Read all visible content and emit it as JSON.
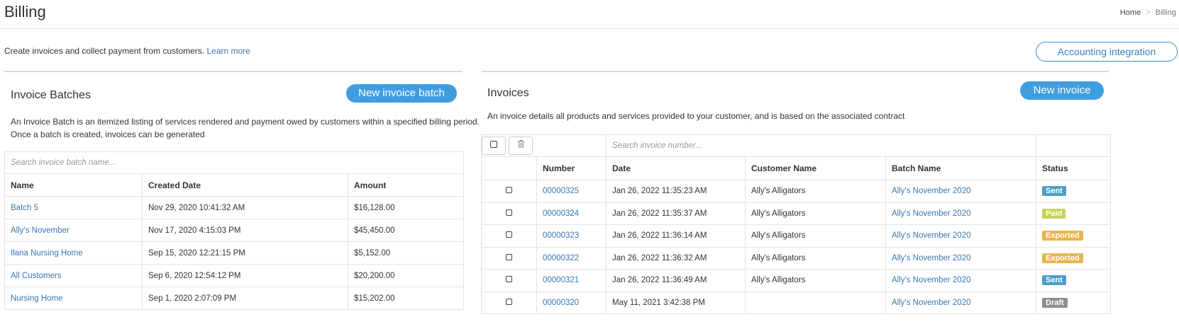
{
  "header": {
    "title": "Billing",
    "breadcrumb": {
      "home": "Home",
      "separator": ">",
      "current": "Billing"
    }
  },
  "intro": {
    "text": "Create invoices and collect payment from customers.",
    "link": "Learn more"
  },
  "accounting_button": "Accounting integration",
  "batches": {
    "title": "Invoice Batches",
    "new_button": "New invoice batch",
    "description_line1": "An Invoice Batch is an itemized listing of services rendered and payment owed by customers within a specified billing period.",
    "description_line2": "Once a batch is created, invoices can be generated",
    "search_placeholder": "Search invoice batch name...",
    "columns": [
      "Name",
      "Created Date",
      "Amount"
    ],
    "rows": [
      {
        "name": "Batch 5",
        "created": "Nov 29, 2020 10:41:32 AM",
        "amount": "$16,128.00"
      },
      {
        "name": "Ally's November",
        "created": "Nov 17, 2020 4:15:03 PM",
        "amount": "$45,450.00"
      },
      {
        "name": "Ilana Nursing Home",
        "created": "Sep 15, 2020 12:21:15 PM",
        "amount": "$5,152.00"
      },
      {
        "name": "All Customers",
        "created": "Sep 6, 2020 12:54:12 PM",
        "amount": "$20,200.00"
      },
      {
        "name": "Nursing Home",
        "created": "Sep 1, 2020 2:07:09 PM",
        "amount": "$15,202.00"
      }
    ]
  },
  "invoices": {
    "title": "Invoices",
    "new_button": "New invoice",
    "description": "An invoice details all products and services provided to your customer, and is based on the associated contract",
    "search_placeholder": "Search invoice number...",
    "toolbar_icons": [
      "checkbox-icon",
      "trash-icon"
    ],
    "columns": [
      "Number",
      "Date",
      "Customer Name",
      "Batch Name",
      "Status"
    ],
    "rows": [
      {
        "number": "00000325",
        "date": "Jan 26, 2022 11:35:23 AM",
        "customer": "Ally's Alligators",
        "batch": "Ally's November 2020",
        "status": "Sent",
        "status_color": "#4b9fc7"
      },
      {
        "number": "00000324",
        "date": "Jan 26, 2022 11:35:37 AM",
        "customer": "Ally's Alligators",
        "batch": "Ally's November 2020",
        "status": "Paid",
        "status_color": "#c6d257"
      },
      {
        "number": "00000323",
        "date": "Jan 26, 2022 11:36:14 AM",
        "customer": "Ally's Alligators",
        "batch": "Ally's November 2020",
        "status": "Exported",
        "status_color": "#e8b54e"
      },
      {
        "number": "00000322",
        "date": "Jan 26, 2022 11:36:32 AM",
        "customer": "Ally's Alligators",
        "batch": "Ally's November 2020",
        "status": "Exported",
        "status_color": "#e8b54e"
      },
      {
        "number": "00000321",
        "date": "Jan 26, 2022 11:36:49 AM",
        "customer": "Ally's Alligators",
        "batch": "Ally's November 2020",
        "status": "Sent",
        "status_color": "#4b9fc7"
      },
      {
        "number": "00000320",
        "date": "May 11, 2021 3:42:38 PM",
        "customer": "",
        "batch": "Ally's November 2020",
        "status": "Draft",
        "status_color": "#8e8e8e"
      }
    ]
  }
}
